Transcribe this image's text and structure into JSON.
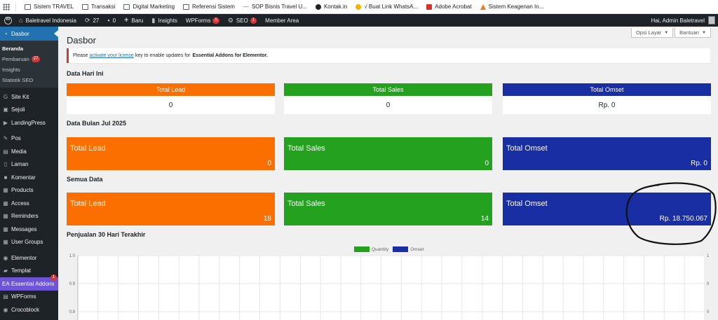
{
  "bookmarks": [
    {
      "label": "Sistem TRAVEL",
      "icon": "folder-icon"
    },
    {
      "label": "Transaksi",
      "icon": "folder-icon"
    },
    {
      "label": "Digital Marketing",
      "icon": "folder-icon"
    },
    {
      "label": "Referensi Sistem",
      "icon": "folder-icon"
    },
    {
      "label": "SOP Bisnis Travel U...",
      "icon": "dash-icon"
    },
    {
      "label": "Kontak.in",
      "icon": "globe-icon"
    },
    {
      "label": "√ Buat Link WhatsA...",
      "icon": "gold-icon"
    },
    {
      "label": "Adobe Acrobat",
      "icon": "acrobat-icon"
    },
    {
      "label": "Sistem Keagenan In...",
      "icon": "orange-icon"
    }
  ],
  "adminbar": {
    "site": "Baletravel Indonesia",
    "updates": "27",
    "comments": "0",
    "new": "Baru",
    "insights": "Insights",
    "wpforms": "WPForms",
    "wpforms_badge": "5",
    "seo": "SEO",
    "seo_badge": "1",
    "member": "Member Area",
    "greeting": "Hai, Admin Baletravel"
  },
  "sidebar": {
    "dasbor": "Dasbor",
    "sub": {
      "beranda": "Beranda",
      "pembaruan": "Pembaruan",
      "pembaruan_badge": "27",
      "insights": "Insights",
      "statistik": "Statistik SEO"
    },
    "items": [
      {
        "label": "Site Kit",
        "icon": "G"
      },
      {
        "label": "Sejoli",
        "icon": "▣"
      },
      {
        "label": "LandingPress",
        "icon": "▶"
      },
      {
        "label": "Pos",
        "icon": "✎"
      },
      {
        "label": "Media",
        "icon": "▤"
      },
      {
        "label": "Laman",
        "icon": "▯"
      },
      {
        "label": "Komentar",
        "icon": "■"
      },
      {
        "label": "Products",
        "icon": "▦"
      },
      {
        "label": "Access",
        "icon": "▦"
      },
      {
        "label": "Reminders",
        "icon": "▦"
      },
      {
        "label": "Messages",
        "icon": "▦"
      },
      {
        "label": "User Groups",
        "icon": "▦"
      }
    ],
    "items2": [
      {
        "label": "Elementor",
        "icon": "◉"
      },
      {
        "label": "Templat",
        "icon": "▰"
      }
    ],
    "ea": {
      "label": "Essential Addons",
      "badge": "1"
    },
    "items3": [
      {
        "label": "WPForms",
        "icon": "▤"
      },
      {
        "label": "Crocoblock",
        "icon": "◉"
      }
    ]
  },
  "main": {
    "title": "Dasbor",
    "screen_options": "Opsi Layar",
    "help": "Bantuan",
    "notice": {
      "pre": "Please",
      "link": "activate your license",
      "mid": "key to enable updates for",
      "bold": "Essential Addons for Elementor."
    },
    "today_title": "Data Hari Ini",
    "month_title": "Data Bulan Jul 2025",
    "all_title": "Semua Data",
    "chart_title": "Penjualan 30 Hari Terakhir",
    "today": [
      {
        "label": "Total Lead",
        "value": "0"
      },
      {
        "label": "Total Sales",
        "value": "0"
      },
      {
        "label": "Total Omset",
        "value": "Rp. 0"
      }
    ],
    "month": [
      {
        "label": "Total Lead",
        "value": "0"
      },
      {
        "label": "Total Sales",
        "value": "0"
      },
      {
        "label": "Total Omset",
        "value": "Rp. 0"
      }
    ],
    "all": [
      {
        "label": "Total Lead",
        "value": "18"
      },
      {
        "label": "Total Sales",
        "value": "14"
      },
      {
        "label": "Total Omset",
        "value": "Rp. 18.750.067"
      }
    ]
  },
  "colors": {
    "lead": "#fb6e00",
    "sales": "#23a11f",
    "omset": "#1a2ea3"
  },
  "chart_data": {
    "type": "line",
    "legend": [
      "Quantity",
      "Omset"
    ],
    "legend_colors": [
      "#23a11f",
      "#1a2ea3"
    ],
    "yticks_left": [
      "1.0",
      "0.9",
      "0.8"
    ],
    "yticks_right": [
      "1",
      "0",
      "0"
    ],
    "series": [
      {
        "name": "Quantity",
        "values": []
      },
      {
        "name": "Omset",
        "values": []
      }
    ]
  }
}
